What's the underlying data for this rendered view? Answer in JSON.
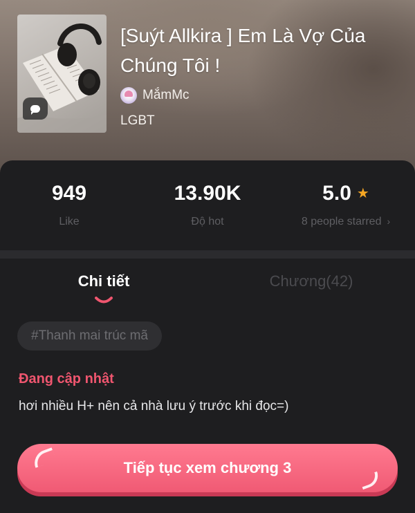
{
  "story": {
    "title": "[Suýt Allkira ] Em Là Vợ Của Chúng Tôi !",
    "author": "MắmMc",
    "category": "LGBT",
    "cover_icon": "chat-bubble-icon"
  },
  "stats": {
    "likes": {
      "value": "949",
      "label": "Like"
    },
    "hot": {
      "value": "13.90K",
      "label": "Độ hot"
    },
    "rating": {
      "value": "5.0",
      "label": "8 people starred",
      "icon": "star-icon",
      "chevron": "›"
    }
  },
  "tabs": [
    {
      "label": "Chi tiết",
      "active": true
    },
    {
      "label": "Chương(42)",
      "active": false
    }
  ],
  "detail": {
    "tag": "#Thanh mai trúc mã",
    "status": "Đang cập nhật",
    "description": "hơi nhiều H+ nên cả nhà lưu ý trước khi đọc=)"
  },
  "cta": {
    "label": "Tiếp tục xem chương 3"
  },
  "colors": {
    "accent": "#f05a74",
    "status": "#f0566f",
    "star": "#f5a623",
    "panel": "#1e1e20"
  }
}
